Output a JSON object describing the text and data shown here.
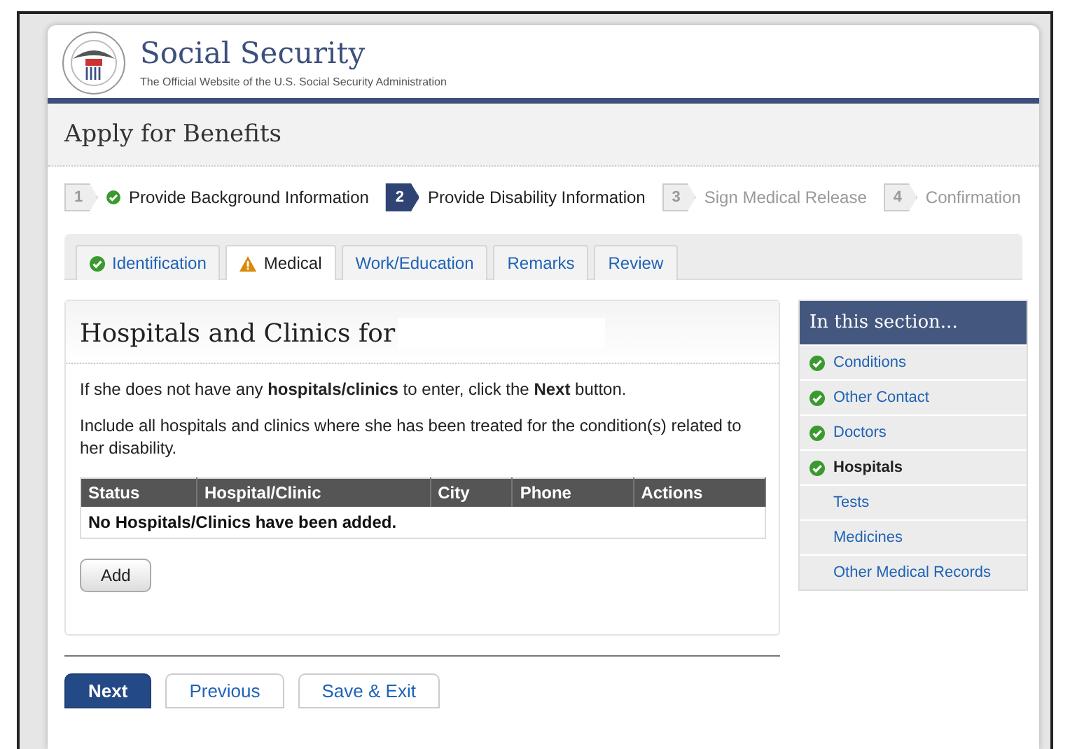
{
  "site": {
    "title": "Social Security",
    "subtitle": "The Official Website of the U.S. Social Security Administration"
  },
  "page_title": "Apply for Benefits",
  "steps": [
    {
      "number": "1",
      "label": "Provide Background Information",
      "kind": "done"
    },
    {
      "number": "2",
      "label": "Provide Disability Information",
      "kind": "current"
    },
    {
      "number": "3",
      "label": "Sign Medical Release",
      "kind": "upcoming"
    },
    {
      "number": "4",
      "label": "Confirmation",
      "kind": "upcoming"
    }
  ],
  "tabs": [
    {
      "label": "Identification",
      "kind": "complete",
      "selected": false
    },
    {
      "label": "Medical",
      "kind": "warning",
      "selected": true
    },
    {
      "label": "Work/Education",
      "kind": "plain",
      "selected": false
    },
    {
      "label": "Remarks",
      "kind": "plain",
      "selected": false
    },
    {
      "label": "Review",
      "kind": "plain",
      "selected": false
    }
  ],
  "panel": {
    "heading": "Hospitals and Clinics for",
    "paragraphs": [
      "If she does not have any **hospitals/clinics** to enter, click the **Next** button.",
      "Include all hospitals and clinics where she has been treated for the condition(s) related to her disability."
    ],
    "table": {
      "columns": [
        "Status",
        "Hospital/Clinic",
        "City",
        "Phone",
        "Actions"
      ],
      "empty_message": "No Hospitals/Clinics have been added."
    },
    "add_button": "Add"
  },
  "sidebar": {
    "title": "In this section...",
    "items": [
      {
        "label": "Conditions",
        "checked": true,
        "selected": false
      },
      {
        "label": "Other Contact",
        "checked": true,
        "selected": false
      },
      {
        "label": "Doctors",
        "checked": true,
        "selected": false
      },
      {
        "label": "Hospitals",
        "checked": true,
        "selected": true
      },
      {
        "label": "Tests",
        "checked": false,
        "selected": false
      },
      {
        "label": "Medicines",
        "checked": false,
        "selected": false
      },
      {
        "label": "Other Medical Records",
        "checked": false,
        "selected": false
      }
    ]
  },
  "footer_buttons": [
    {
      "label": "Next",
      "kind": "primary"
    },
    {
      "label": "Previous",
      "kind": "secondary"
    },
    {
      "label": "Save & Exit",
      "kind": "secondary"
    }
  ]
}
